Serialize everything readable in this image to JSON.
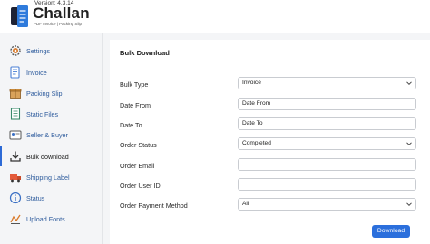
{
  "header": {
    "version": "Version: 4.3.14",
    "brand": "Challan",
    "tagline": "PDF Invoice | Packing Slip"
  },
  "sidebar": {
    "items": [
      {
        "label": "Settings",
        "icon": "gear-icon"
      },
      {
        "label": "Invoice",
        "icon": "invoice-icon"
      },
      {
        "label": "Packing Slip",
        "icon": "package-icon"
      },
      {
        "label": "Static Files",
        "icon": "document-icon"
      },
      {
        "label": "Seller & Buyer",
        "icon": "handshake-icon"
      },
      {
        "label": "Bulk download",
        "icon": "download-icon"
      },
      {
        "label": "Shipping Label",
        "icon": "truck-icon"
      },
      {
        "label": "Status",
        "icon": "info-icon"
      },
      {
        "label": "Upload Fonts",
        "icon": "upload-icon"
      }
    ],
    "active": "Bulk download"
  },
  "panel": {
    "title": "Bulk Download",
    "fields": {
      "bulk_type": {
        "label": "Bulk Type",
        "value": "Invoice"
      },
      "date_from": {
        "label": "Date From",
        "value": "Date From"
      },
      "date_to": {
        "label": "Date To",
        "value": "Date To"
      },
      "order_status": {
        "label": "Order Status",
        "value": "Completed"
      },
      "order_email": {
        "label": "Order Email",
        "value": ""
      },
      "order_user_id": {
        "label": "Order User ID",
        "value": ""
      },
      "payment_method": {
        "label": "Order Payment Method",
        "value": "All"
      }
    },
    "download_label": "Download"
  },
  "colors": {
    "accent": "#2b6fdc",
    "nav_text": "#2c5a9c",
    "active_marker": "#2d6ad6"
  }
}
